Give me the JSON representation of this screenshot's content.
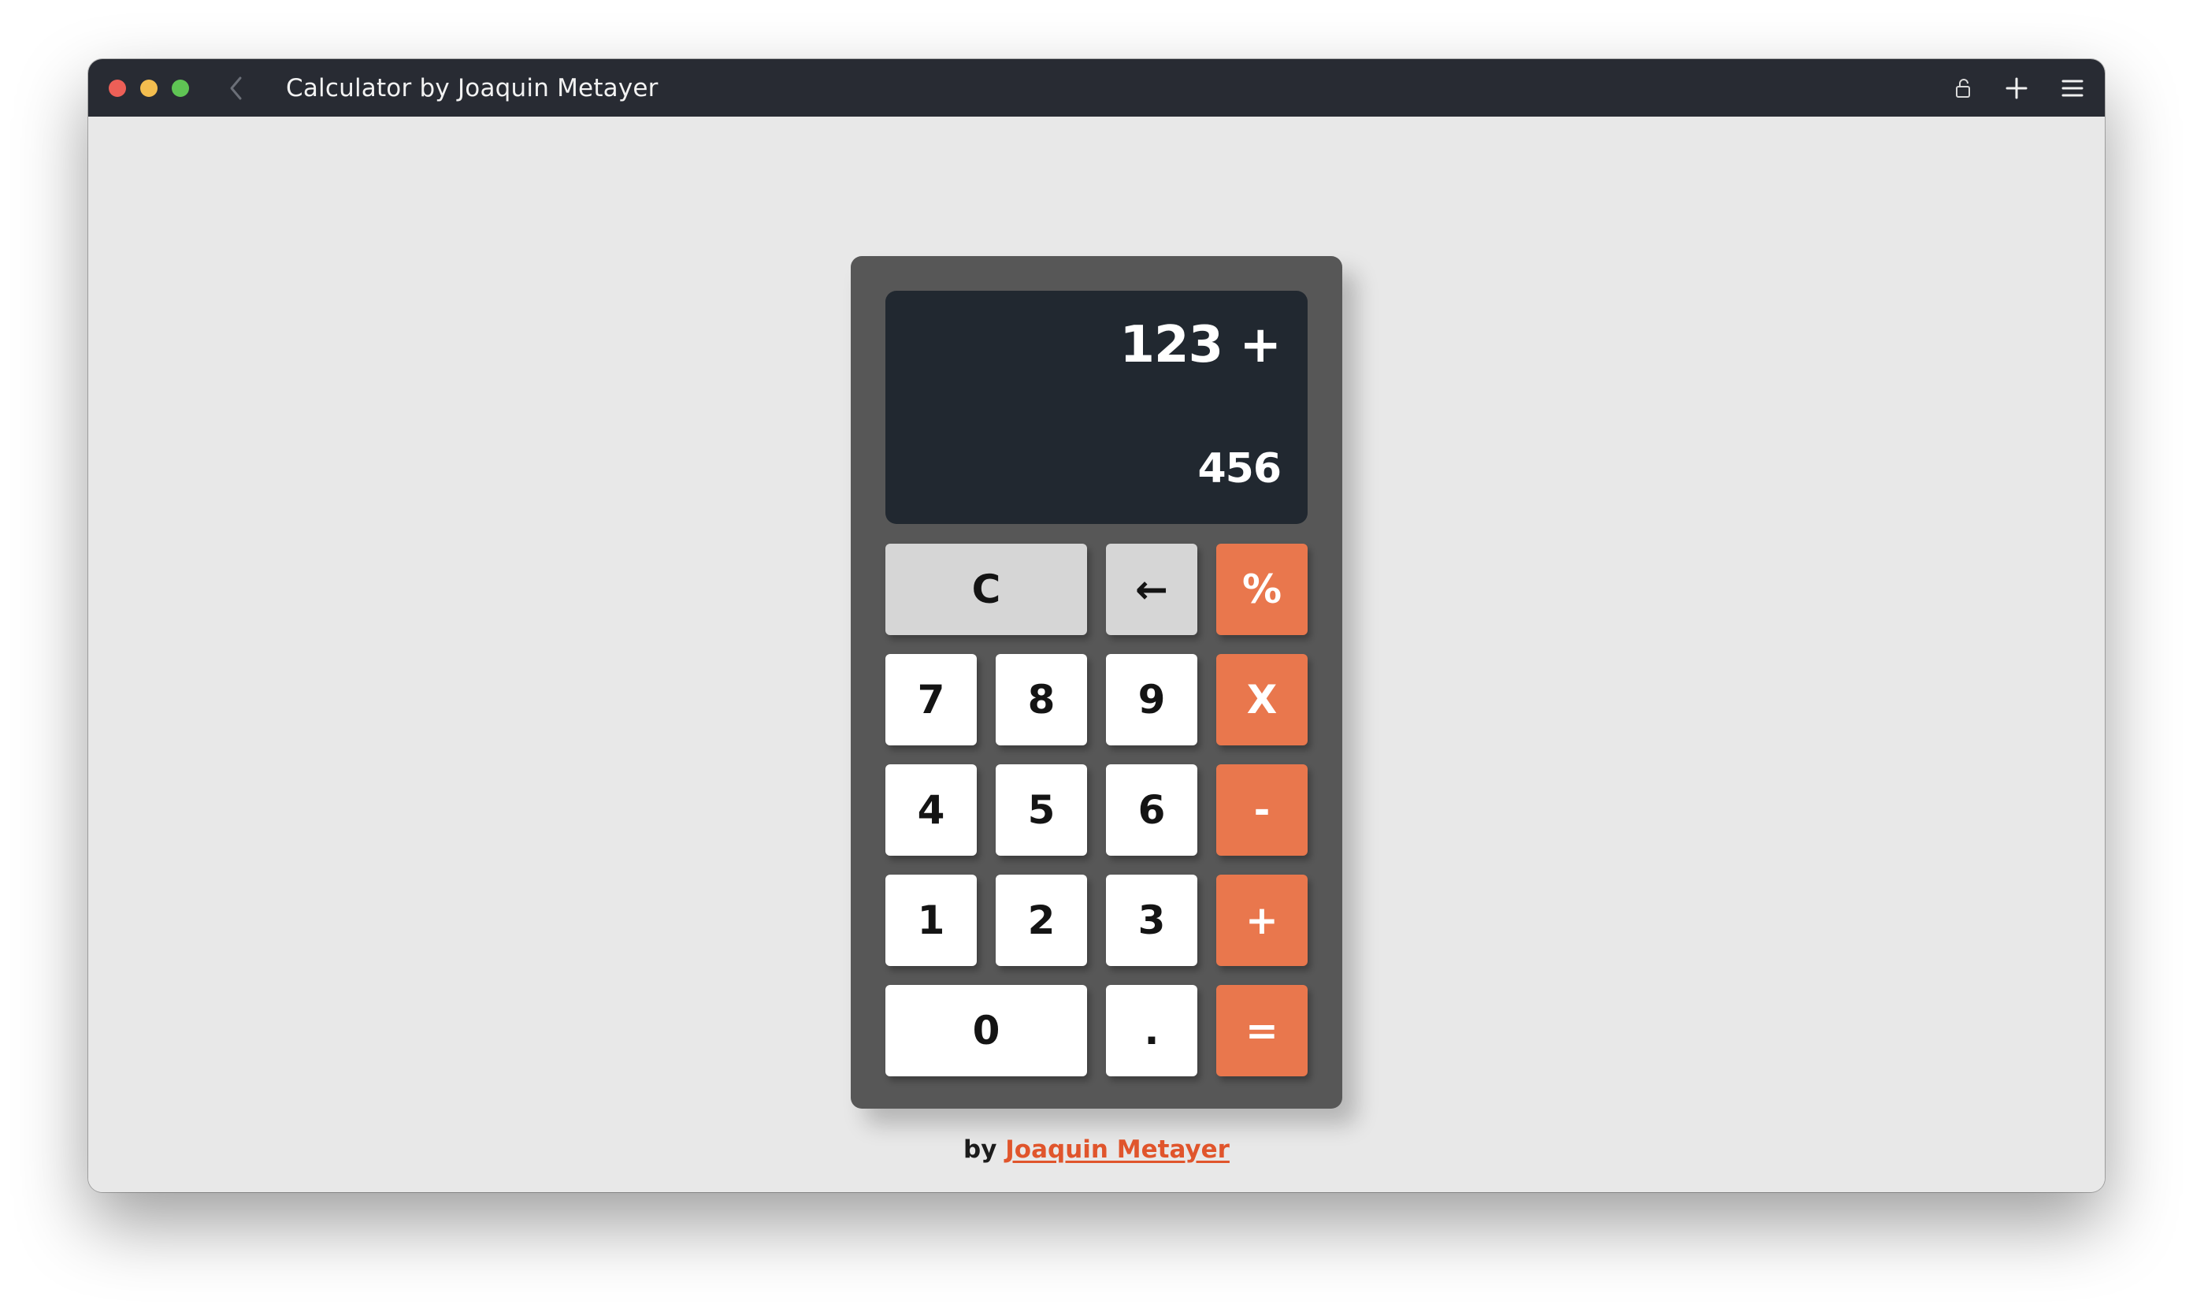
{
  "window": {
    "title": "Calculator by Joaquin Metayer"
  },
  "titlebar_icons": {
    "back": "chevron-left-icon",
    "lock": "lock-icon",
    "new_tab": "plus-icon",
    "menu": "hamburger-menu-icon"
  },
  "calculator": {
    "display": {
      "previous": "123 +",
      "current": "456"
    },
    "keys": {
      "clear": "C",
      "backspace": "←",
      "percent": "%",
      "seven": "7",
      "eight": "8",
      "nine": "9",
      "multiply": "X",
      "four": "4",
      "five": "5",
      "six": "6",
      "subtract": "-",
      "one": "1",
      "two": "2",
      "three": "3",
      "add": "+",
      "zero": "0",
      "decimal": ".",
      "equals": "="
    }
  },
  "footer": {
    "prefix": "by",
    "author_link": "Joaquin Metayer"
  },
  "colors": {
    "titlebar": "#282b33",
    "page_background": "#e8e8e8",
    "calculator_body": "#575757",
    "display_background": "#212830",
    "operator_key": "#e9774d",
    "function_key": "#d6d6d6",
    "number_key": "#ffffff",
    "link": "#e0552c"
  }
}
